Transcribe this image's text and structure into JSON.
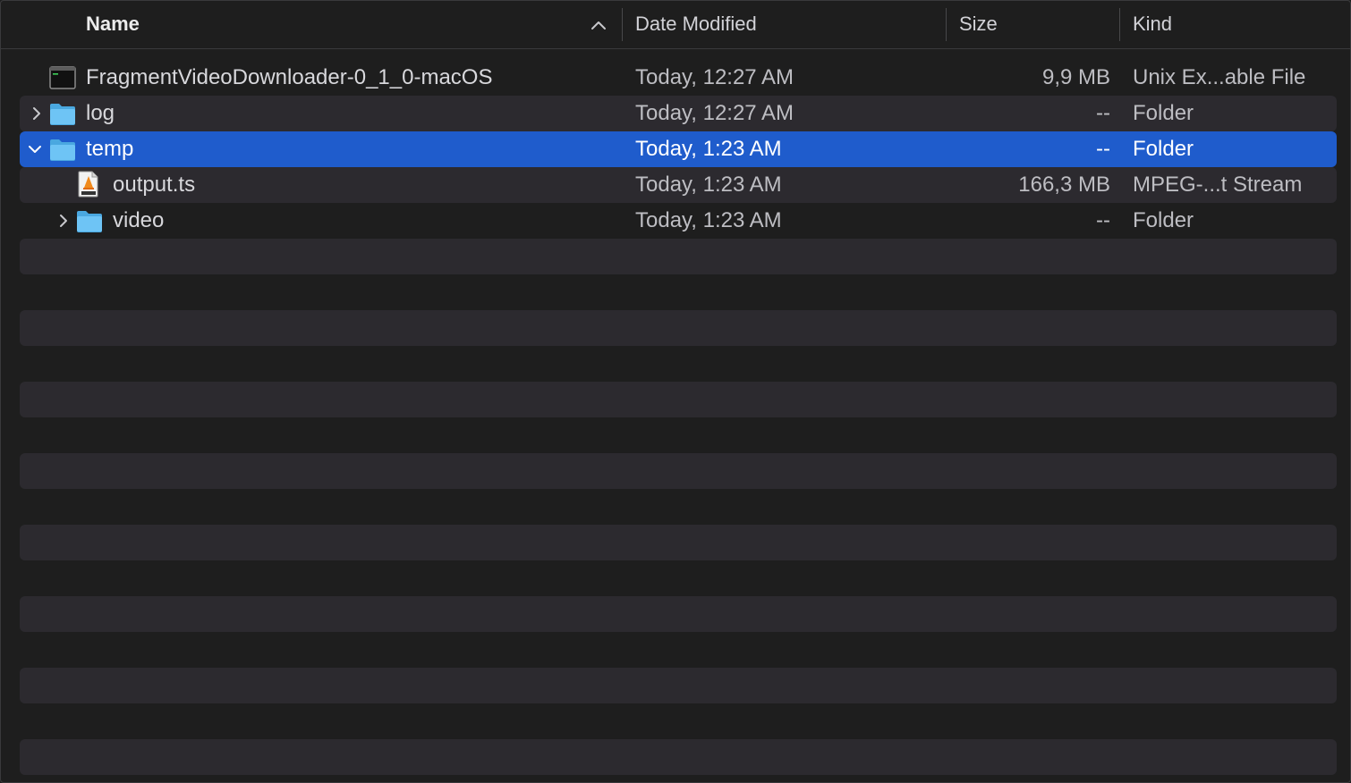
{
  "columns": {
    "name": "Name",
    "date": "Date Modified",
    "size": "Size",
    "kind": "Kind"
  },
  "sort": {
    "column": "Name",
    "direction": "ascending",
    "icon": "chevron-up-icon"
  },
  "rows": [
    {
      "name": "FragmentVideoDownloader-0_1_0-macOS",
      "date": "Today, 12:27 AM",
      "size": "9,9 MB",
      "kind": "Unix Ex...able File",
      "icon": "terminal-executable-icon",
      "disclosure": null,
      "depth": 0
    },
    {
      "name": "log",
      "date": "Today, 12:27 AM",
      "size": "--",
      "kind": "Folder",
      "icon": "folder-icon",
      "disclosure": "collapsed",
      "depth": 0
    },
    {
      "name": "temp",
      "date": "Today, 1:23 AM",
      "size": "--",
      "kind": "Folder",
      "icon": "folder-icon",
      "disclosure": "expanded",
      "depth": 0,
      "selected": true
    },
    {
      "name": "output.ts",
      "date": "Today, 1:23 AM",
      "size": "166,3 MB",
      "kind": "MPEG-...t Stream",
      "icon": "mpeg-document-icon",
      "disclosure": null,
      "depth": 1
    },
    {
      "name": "video",
      "date": "Today, 1:23 AM",
      "size": "--",
      "kind": "Folder",
      "icon": "folder-icon",
      "disclosure": "collapsed",
      "depth": 1
    }
  ],
  "colors": {
    "background": "#1e1e1e",
    "stripe": "#2c2a2f",
    "selection": "#1f5ccc",
    "folder": "#5ab8f0"
  }
}
